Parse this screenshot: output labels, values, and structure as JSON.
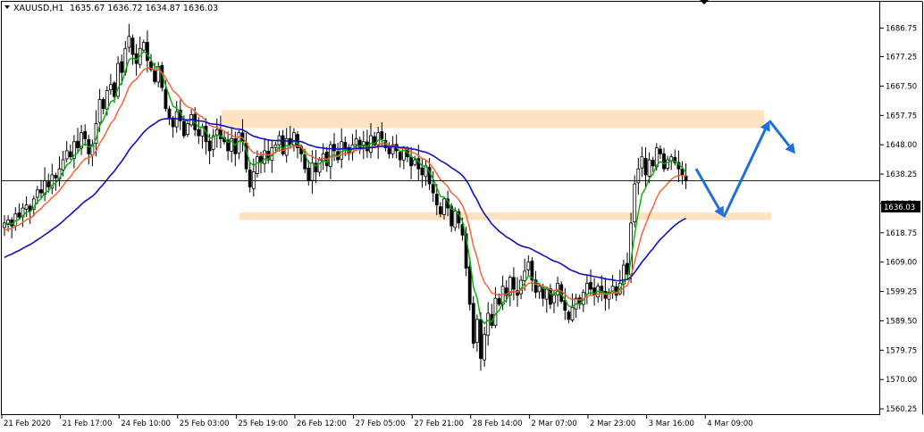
{
  "header": {
    "symbol": "XAUUSD,H1",
    "ohlc": "1635.67 1636.72 1634.87 1636.03"
  },
  "price_label": "1636.03",
  "colors": {
    "background": "#ffffff",
    "bull": "#00aa00",
    "bear": "#000000",
    "ma_fast": "#00b000",
    "ma_mid": "#ff5a2d",
    "ma_slow": "#1010c0",
    "zones": "#fde3c2",
    "arrows": "#1e6fdc"
  },
  "chart_data": {
    "type": "candlestick",
    "title": "XAUUSD,H1",
    "ylim": [
      1558.5,
      1695.5
    ],
    "y_ticks": [
      1686.75,
      1677.25,
      1667.5,
      1657.75,
      1648.0,
      1638.25,
      1628.5,
      1618.75,
      1609.0,
      1599.25,
      1589.5,
      1579.75,
      1570.0,
      1560.25
    ],
    "x_ticks": [
      "21 Feb 2020",
      "21 Feb 17:00",
      "24 Feb 10:00",
      "25 Feb 03:00",
      "25 Feb 19:00",
      "26 Feb 12:00",
      "27 Feb 05:00",
      "27 Feb 21:00",
      "28 Feb 14:00",
      "2 Mar 07:00",
      "2 Mar 23:00",
      "3 Mar 16:00",
      "4 Mar 09:00"
    ],
    "last_price": 1636.03,
    "bars_per_label": 16,
    "closes": [
      1622,
      1623,
      1621,
      1625,
      1624,
      1627,
      1628,
      1626,
      1630,
      1633,
      1632,
      1636,
      1634,
      1638,
      1637,
      1640,
      1643,
      1646,
      1644,
      1649,
      1647,
      1652,
      1650,
      1645,
      1648,
      1655,
      1663,
      1660,
      1666,
      1668,
      1664,
      1675,
      1672,
      1680,
      1684,
      1678,
      1675,
      1680,
      1682,
      1676,
      1673,
      1669,
      1674,
      1667,
      1660,
      1657,
      1654,
      1659,
      1656,
      1651,
      1655,
      1658,
      1653,
      1651,
      1654,
      1649,
      1646,
      1651,
      1653,
      1650,
      1649,
      1646,
      1650,
      1645,
      1652,
      1649,
      1640,
      1634,
      1639,
      1644,
      1642,
      1646,
      1643,
      1647,
      1648,
      1651,
      1645,
      1650,
      1648,
      1652,
      1647,
      1645,
      1640,
      1636,
      1642,
      1639,
      1643,
      1645,
      1641,
      1648,
      1646,
      1643,
      1649,
      1647,
      1645,
      1648,
      1650,
      1647,
      1649,
      1646,
      1651,
      1648,
      1652,
      1650,
      1647,
      1645,
      1648,
      1646,
      1643,
      1647,
      1644,
      1641,
      1643,
      1640,
      1638,
      1641,
      1635,
      1632,
      1628,
      1625,
      1630,
      1627,
      1621,
      1626,
      1622,
      1618,
      1607,
      1595,
      1582,
      1590,
      1577,
      1585,
      1592,
      1588,
      1597,
      1595,
      1601,
      1598,
      1604,
      1600,
      1598,
      1603,
      1606,
      1609,
      1603,
      1599,
      1601,
      1597,
      1600,
      1595,
      1598,
      1602,
      1596,
      1593,
      1590,
      1594,
      1597,
      1595,
      1599,
      1602,
      1600,
      1598,
      1601,
      1599,
      1597,
      1599,
      1601,
      1598,
      1602,
      1608,
      1605,
      1622,
      1635,
      1640,
      1644,
      1638,
      1643,
      1641,
      1647,
      1645,
      1640,
      1643,
      1644,
      1642,
      1640,
      1638,
      1636
    ],
    "series": [
      {
        "type": "line",
        "period": 5,
        "color": "#00b000"
      },
      {
        "type": "line",
        "period": 12,
        "color": "#ff5a2d"
      },
      {
        "type": "line",
        "period": 40,
        "color": "#1010c0"
      }
    ],
    "zones": [
      {
        "from": 1653.5,
        "to": 1659.5
      },
      {
        "from": 1623.0,
        "to": 1625.5
      }
    ],
    "forecast_path": [
      1640,
      1624,
      1656,
      1645
    ]
  }
}
